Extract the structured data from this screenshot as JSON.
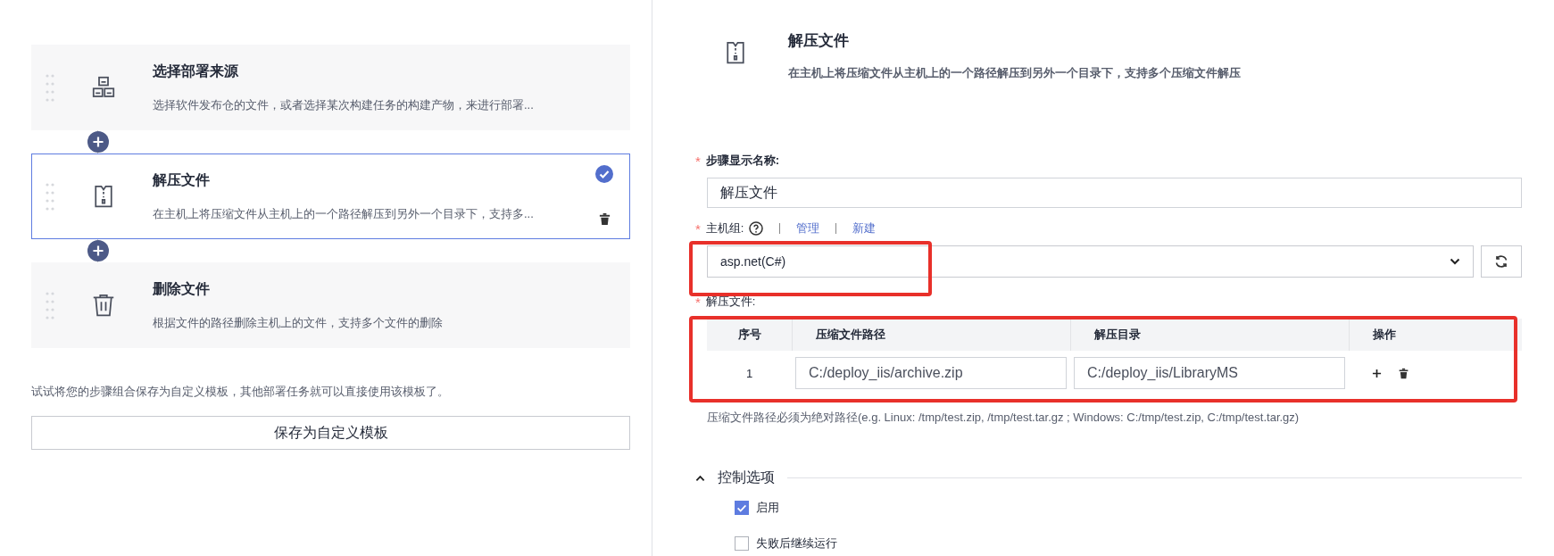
{
  "steps": [
    {
      "kind": "source",
      "title": "选择部署来源",
      "description": "选择软件发布仓的文件，或者选择某次构建任务的构建产物，来进行部署...",
      "selected": false
    },
    {
      "kind": "unzip",
      "title": "解压文件",
      "description": "在主机上将压缩文件从主机上的一个路径解压到另外一个目录下，支持多...",
      "selected": true
    },
    {
      "kind": "delete",
      "title": "删除文件",
      "description": "根据文件的路径删除主机上的文件，支持多个文件的删除",
      "selected": false
    }
  ],
  "template_hint": "试试将您的步骤组合保存为自定义模板，其他部署任务就可以直接使用该模板了。",
  "save_template_button": "保存为自定义模板",
  "detail": {
    "title": "解压文件",
    "description": "在主机上将压缩文件从主机上的一个路径解压到另外一个目录下，支持多个压缩文件解压"
  },
  "step_name": {
    "required_mark": "*",
    "label": "步骤显示名称:",
    "value": "解压文件"
  },
  "host_group": {
    "required_mark": "*",
    "label": "主机组:",
    "links": [
      "管理",
      "新建"
    ],
    "value": "asp.net(C#)",
    "highlighted": true
  },
  "files": {
    "required_mark": "*",
    "label": "解压文件:",
    "highlighted": true,
    "columns": [
      "序号",
      "压缩文件路径",
      "解压目录",
      "操作"
    ],
    "rows": [
      {
        "index": "1",
        "archive_path": "C:/deploy_iis/archive.zip",
        "target_dir": "C:/deploy_iis/LibraryMS"
      }
    ],
    "hint": "压缩文件路径必须为绝对路径(e.g. Linux: /tmp/test.zip, /tmp/test.tar.gz ; Windows: C:/tmp/test.zip, C:/tmp/test.tar.gz)"
  },
  "control_options": {
    "title": "控制选项",
    "expanded": true,
    "options": [
      {
        "label": "启用",
        "checked": true
      },
      {
        "label": "失败后继续运行",
        "checked": false
      }
    ]
  }
}
